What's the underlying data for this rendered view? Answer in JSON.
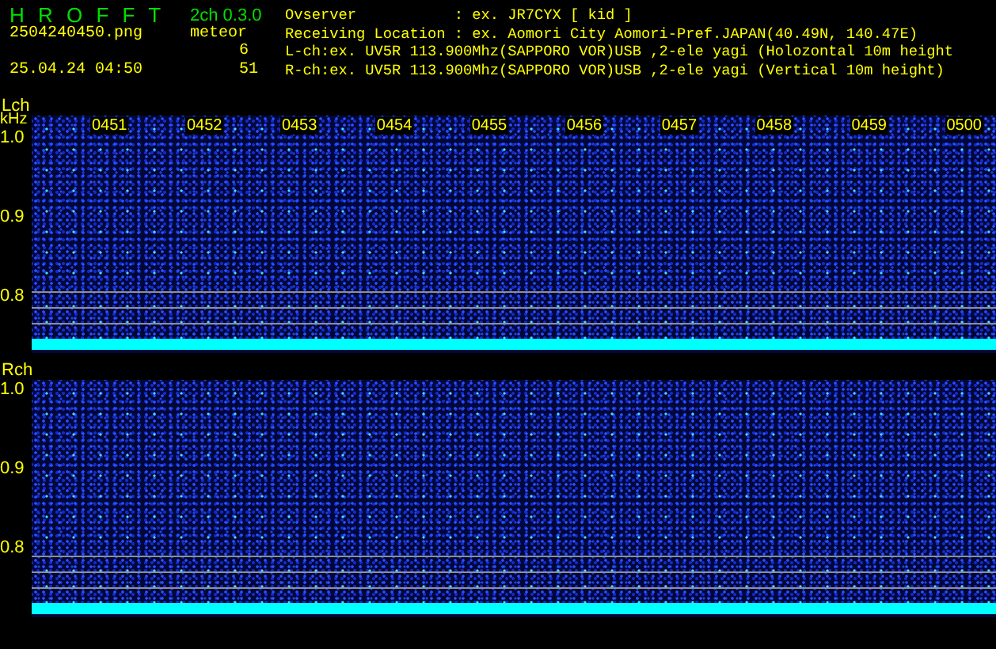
{
  "app": {
    "title": "H R O F F T",
    "version": "2ch 0.3.0"
  },
  "file": {
    "name": "2504240450.png",
    "datetime": "25.04.24 04:50"
  },
  "meteor_label": "meteor",
  "info_lines": [
    "Ovserver           : ex. JR7CYX [ kid ]",
    "Receiving Location : ex. Aomori City Aomori-Pref.JAPAN(40.49N, 140.47E)"
  ],
  "channels": [
    {
      "name": "Lch",
      "unit": "kHz",
      "count": "6",
      "info": "L-ch:ex. UV5R 113.900Mhz(SAPPORO VOR)USB ,2-ele yagi (Holozontal 10m height",
      "time_labels": [
        "0451",
        "0452",
        "0453",
        "0454",
        "0455",
        "0456",
        "0457",
        "0458",
        "0459",
        "0500"
      ],
      "axis_labels": [
        "1.0",
        "0.9",
        "0.8"
      ]
    },
    {
      "name": "Rch",
      "count": "51",
      "info": "R-ch:ex. UV5R 113.900Mhz(SAPPORO VOR)USB ,2-ele yagi (Vertical 10m height)",
      "axis_labels": [
        "1.0",
        "0.9",
        "0.8"
      ]
    }
  ]
}
